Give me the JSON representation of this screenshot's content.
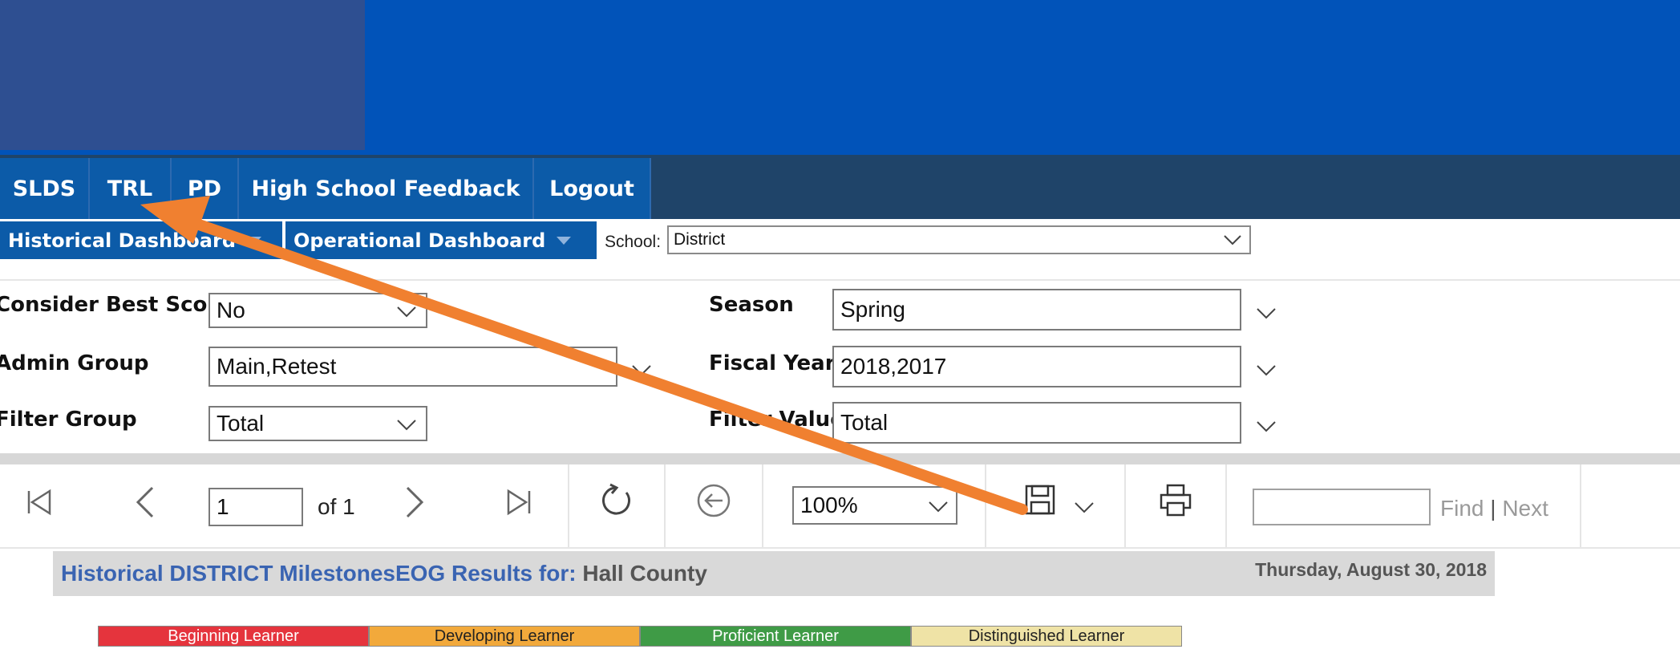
{
  "nav": {
    "items": [
      {
        "label": "SLDS"
      },
      {
        "label": "TRL"
      },
      {
        "label": "PD"
      },
      {
        "label": "High School Feedback"
      },
      {
        "label": "Logout"
      }
    ]
  },
  "dashboards": {
    "historical_label": "Historical Dashboard",
    "operational_label": "Operational Dashboard"
  },
  "school": {
    "label": "School:",
    "value": "District"
  },
  "filters": {
    "consider_best_score": {
      "label": "Consider Best Score",
      "value": "No"
    },
    "admin_group": {
      "label": "Admin Group",
      "value": "Main,Retest"
    },
    "filter_group": {
      "label": "Filter Group",
      "value": "Total"
    },
    "season": {
      "label": "Season",
      "value": "Spring"
    },
    "fiscal_year": {
      "label": "Fiscal Year",
      "value": "2018,2017"
    },
    "filter_value": {
      "label": "Filter Value",
      "value": "Total"
    }
  },
  "toolbar": {
    "page_value": "1",
    "of_label": "of 1",
    "zoom_value": "100%",
    "find_label": "Find",
    "separator": "|",
    "next_label": "Next",
    "find_placeholder": ""
  },
  "report": {
    "title_prefix": "Historical  DISTRICT MilestonesEOG Results for:",
    "county": "Hall County",
    "date": "Thursday, August 30, 2018"
  },
  "legend": [
    {
      "label": "Beginning Learner",
      "color": "#e5343d",
      "text_color": "#ffffff"
    },
    {
      "label": "Developing Learner",
      "color": "#f2a93b",
      "text_color": "#222222"
    },
    {
      "label": "Proficient Learner",
      "color": "#3f9b46",
      "text_color": "#ffffff"
    },
    {
      "label": "Distinguished Learner",
      "color": "#efe3a6",
      "text_color": "#222222"
    }
  ],
  "annotation": {
    "arrow_color": "#f08030"
  }
}
